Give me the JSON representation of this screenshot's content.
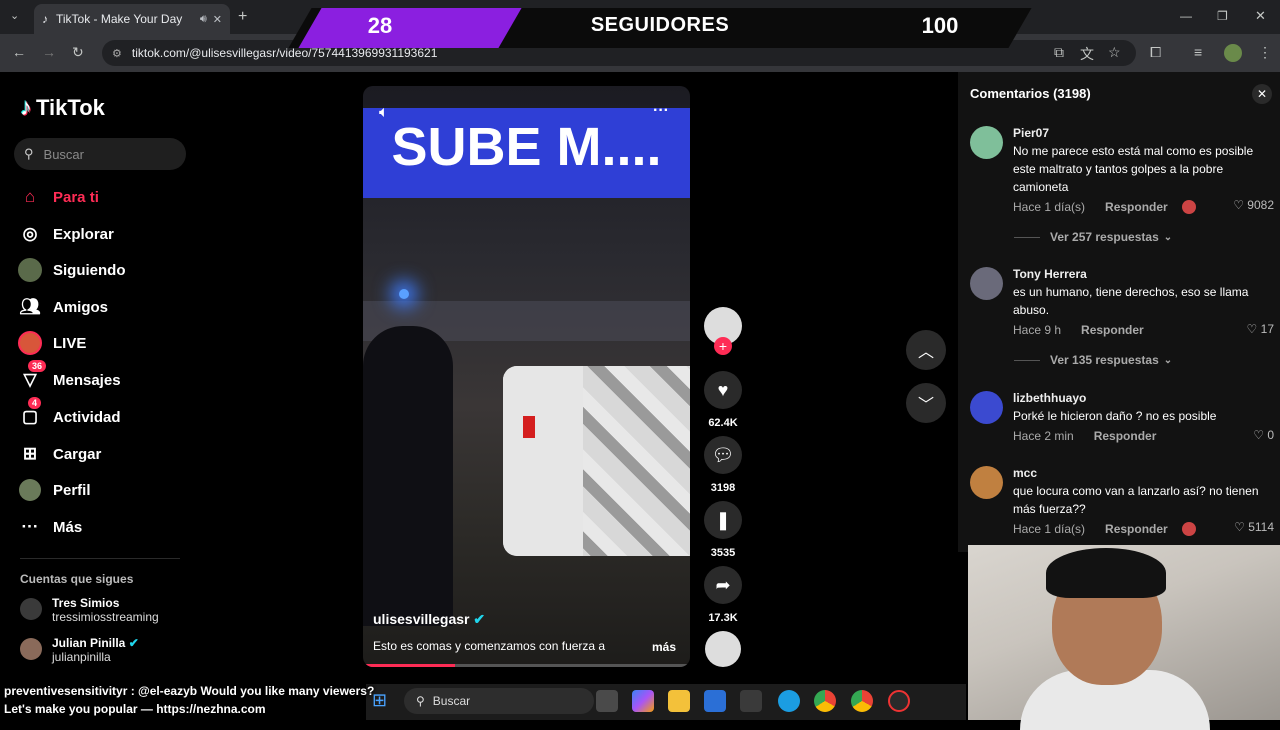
{
  "browser": {
    "tab_title": "TikTok - Make Your Day",
    "url": "tiktok.com/@ulisesvillegasr/video/7574413969931193621"
  },
  "overlay": {
    "left": "28",
    "middle": "SEGUIDORES",
    "right": "100"
  },
  "sidebar": {
    "logo": "TikTok",
    "search_placeholder": "Buscar",
    "items": [
      {
        "label": "Para ti",
        "icon": "home-icon"
      },
      {
        "label": "Explorar",
        "icon": "compass-icon"
      },
      {
        "label": "Siguiendo",
        "icon": "following-icon"
      },
      {
        "label": "Amigos",
        "icon": "friends-icon"
      },
      {
        "label": "LIVE",
        "icon": "live-icon"
      },
      {
        "label": "Mensajes",
        "icon": "messages-icon",
        "badge": "36"
      },
      {
        "label": "Actividad",
        "icon": "activity-icon",
        "badge": "4"
      },
      {
        "label": "Cargar",
        "icon": "upload-icon"
      },
      {
        "label": "Perfil",
        "icon": "profile-icon"
      },
      {
        "label": "Más",
        "icon": "more-icon"
      }
    ],
    "following_heading": "Cuentas que sigues",
    "accounts": [
      {
        "name": "Tres Simios",
        "handle": "tressimiosstreaming"
      },
      {
        "name": "Julian Pinilla",
        "handle": "julianpinilla"
      }
    ]
  },
  "video": {
    "banner": "SUBE M....",
    "username": "ulisesvillegasr",
    "description": "Esto es comas y comenzamos con fuerza a",
    "more": "más",
    "progress": 0.28
  },
  "actions": {
    "likes": "62.4K",
    "comments": "3198",
    "saves": "3535",
    "shares": "17.3K"
  },
  "comments": {
    "title": "Comentarios (3198)",
    "reply_label": "Responder",
    "items": [
      {
        "name": "Pier07",
        "text": "No me parece esto está mal como es posible este maltrato y tantos golpes a la pobre camioneta",
        "time": "Hace 1 día(s)",
        "likes": "9082",
        "replies": "Ver 257 respuestas",
        "color": "#7fbf9a"
      },
      {
        "name": "Tony Herrera",
        "text": "es un humano, tiene derechos, eso se llama abuso.",
        "time": "Hace 9 h",
        "likes": "17",
        "replies": "Ver 135 respuestas",
        "color": "#6a6a7a"
      },
      {
        "name": "lizbethhuayo",
        "text": "Porké le hicieron daño ? no es posible",
        "time": "Hace 2 min",
        "likes": "0",
        "color": "#3b4ad0"
      },
      {
        "name": "mcc",
        "text": "que locura como van a lanzarlo así? no tienen más fuerza??",
        "time": "Hace 1 día(s)",
        "likes": "5114",
        "color": "#c08040"
      }
    ]
  },
  "chat": {
    "line1": "preventivesensitivityr : @el-eazyb Would you like many viewers?",
    "line2": "Let's make you popular — https://nezhna.com"
  },
  "taskbar": {
    "search": "Buscar"
  }
}
